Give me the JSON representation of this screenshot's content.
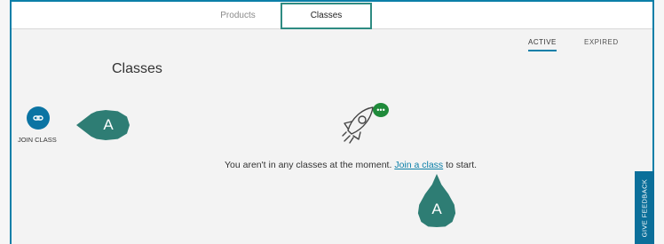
{
  "tabs": [
    {
      "label": "Products"
    },
    {
      "label": "Classes"
    }
  ],
  "filters": {
    "active": "ACTIVE",
    "expired": "EXPIRED"
  },
  "page": {
    "title": "Classes"
  },
  "join": {
    "label": "JOIN CLASS",
    "icon": "link-icon"
  },
  "callouts": {
    "a1": "A",
    "a2": "A"
  },
  "empty_state": {
    "icon": "rocket-icon",
    "badge_icon": "chat-dots-icon",
    "before": "You aren't in any classes at the moment. ",
    "link": "Join a class",
    "after": " to start."
  },
  "feedback": {
    "label": "GIVE FEEDBACK"
  },
  "colors": {
    "accent": "#0b7fa8",
    "callout": "#2e7d74",
    "badge": "#1f8a3a"
  }
}
